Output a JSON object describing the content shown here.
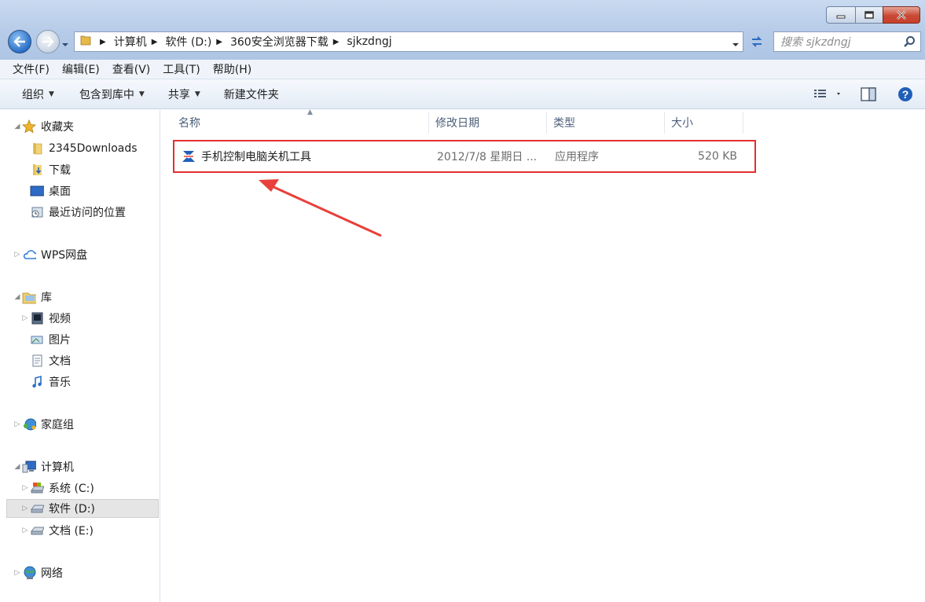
{
  "address": {
    "crumbs": [
      "计算机",
      "软件 (D:)",
      "360安全浏览器下载",
      "sjkzdngj"
    ]
  },
  "search": {
    "placeholder": "搜索 sjkzdngj"
  },
  "menubar": [
    "文件(F)",
    "编辑(E)",
    "查看(V)",
    "工具(T)",
    "帮助(H)"
  ],
  "commands": {
    "organize": "组织",
    "include_library": "包含到库中",
    "share": "共享",
    "new_folder": "新建文件夹"
  },
  "nav": {
    "favorites": "收藏夹",
    "downloads2345": "2345Downloads",
    "downloads": "下载",
    "desktop": "桌面",
    "recent": "最近访问的位置",
    "wps": "WPS网盘",
    "libraries": "库",
    "videos": "视频",
    "pictures": "图片",
    "documents": "文档",
    "music": "音乐",
    "homegroup": "家庭组",
    "computer": "计算机",
    "drive_c": "系统 (C:)",
    "drive_d": "软件 (D:)",
    "drive_e": "文档 (E:)",
    "network": "网络"
  },
  "columns": {
    "name": "名称",
    "modified": "修改日期",
    "type": "类型",
    "size": "大小"
  },
  "files": [
    {
      "name": "手机控制电脑关机工具",
      "modified": "2012/7/8 星期日 ...",
      "type": "应用程序",
      "size": "520 KB"
    }
  ],
  "colors": {
    "highlight_box": "#e3302f",
    "annotation_arrow": "#e8403a"
  }
}
